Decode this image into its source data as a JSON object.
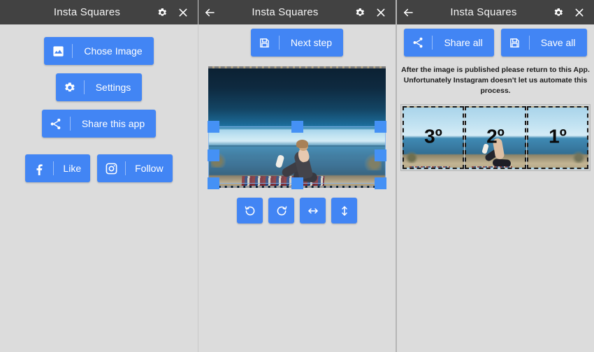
{
  "app": {
    "title": "Insta Squares"
  },
  "panels": [
    {
      "id": "panel-chooser",
      "titlebar": {
        "title": "Insta Squares",
        "has_back": false,
        "settings_icon": "gear-icon",
        "close_icon": "close-icon"
      },
      "buttons": [
        {
          "label": "Chose Image",
          "icon": "image-icon"
        },
        {
          "label": "Settings",
          "icon": "gear-icon"
        },
        {
          "label": "Share this app",
          "icon": "share-icon"
        }
      ],
      "social": [
        {
          "label": "Like",
          "icon": "facebook-icon"
        },
        {
          "label": "Follow",
          "icon": "instagram-icon"
        }
      ]
    },
    {
      "id": "panel-editor",
      "titlebar": {
        "title": "Insta Squares",
        "has_back": true,
        "back_icon": "back-arrow-icon",
        "settings_icon": "gear-icon",
        "close_icon": "close-icon"
      },
      "next_button": {
        "label": "Next step",
        "icon": "save-icon"
      },
      "tools": [
        {
          "name": "rotate-left",
          "icon": "rotate-left-icon"
        },
        {
          "name": "rotate-right",
          "icon": "rotate-right-icon"
        },
        {
          "name": "flip-horizontal",
          "icon": "flip-horizontal-icon"
        },
        {
          "name": "flip-vertical",
          "icon": "flip-vertical-icon"
        }
      ]
    },
    {
      "id": "panel-result",
      "titlebar": {
        "title": "Insta Squares",
        "has_back": true,
        "back_icon": "back-arrow-icon",
        "settings_icon": "gear-icon",
        "close_icon": "close-icon"
      },
      "actions": [
        {
          "label": "Share all",
          "icon": "share-icon"
        },
        {
          "label": "Save all",
          "icon": "save-icon"
        }
      ],
      "note_line1": "After the image is published please return to this App.",
      "note_line2": "Unfortunately Instagram doesn't let us automate this process.",
      "segments": [
        {
          "label": "3º"
        },
        {
          "label": "2º"
        },
        {
          "label": "1º"
        }
      ]
    }
  ],
  "colors": {
    "accent_blue": "#4285f4",
    "titlebar": "#424242",
    "background": "#dcdcdc",
    "divider": "#b5b5b5"
  }
}
